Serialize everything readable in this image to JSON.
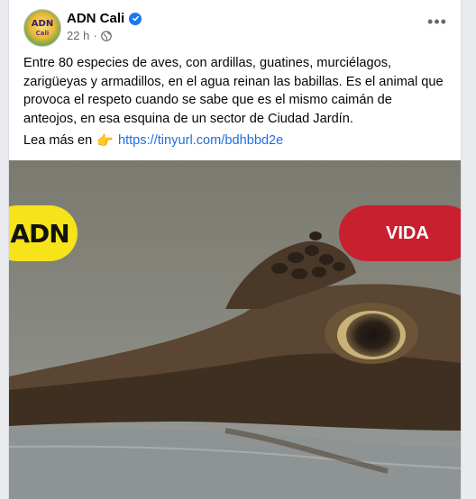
{
  "post": {
    "page_name": "ADN Cali",
    "time": "22 h",
    "avatar": {
      "line1": "ADN",
      "line2": "Cali"
    },
    "more_icon": "more-horizontal-icon",
    "verified_icon": "verified-badge-icon",
    "privacy_icon": "globe-icon",
    "text": "Entre 80 especies de aves, con ardillas, guatines, murciélagos, zarigüeyas y armadillos, en el agua reinan las babillas. Es el animal que provoca el respeto cuando se sabe que es el mismo caimán de anteojos, en esa esquina de un sector de Ciudad Jardín.",
    "read_more_label": "Lea más en",
    "read_more_icon": "pointing-hand-icon",
    "link": "https://tinyurl.com/bdhbbd2e"
  },
  "image": {
    "logo_text": "ADN",
    "section_label": "VIDA",
    "colors": {
      "logo_bg": "#f6e31a",
      "section_bg": "#c8202f",
      "link": "#216fdb",
      "verified": "#1877f2"
    }
  }
}
